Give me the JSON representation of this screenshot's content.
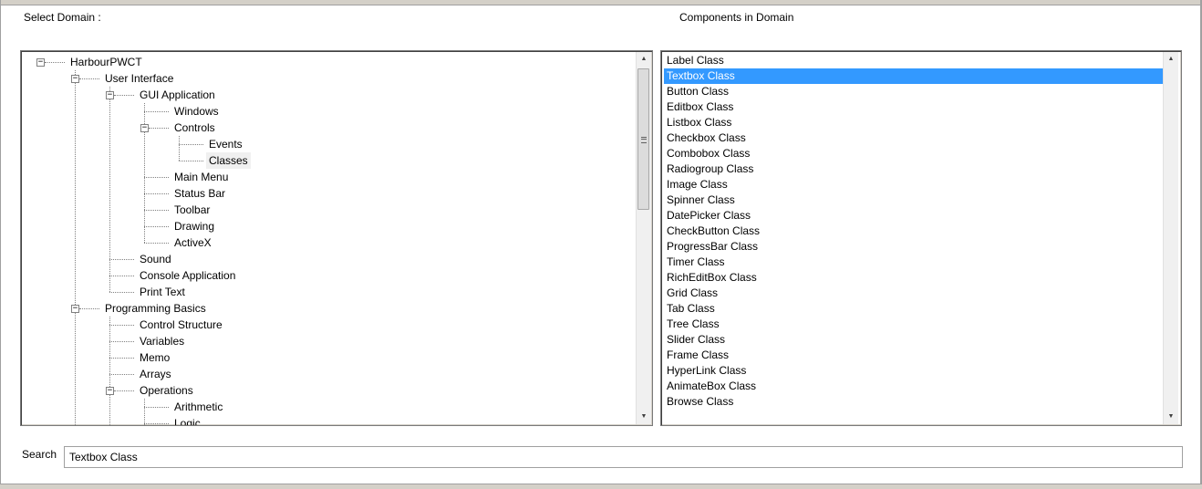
{
  "labels": {
    "select_domain": "Select Domain :",
    "components_in_domain": "Components in Domain",
    "search": "Search"
  },
  "tree": {
    "nodes": [
      {
        "label": "HarbourPWCT",
        "depth": 0,
        "expanded": true
      },
      {
        "label": "User Interface",
        "depth": 1,
        "expanded": true
      },
      {
        "label": "GUI Application",
        "depth": 2,
        "expanded": true
      },
      {
        "label": "Windows",
        "depth": 3
      },
      {
        "label": "Controls",
        "depth": 3,
        "expanded": true
      },
      {
        "label": "Events",
        "depth": 4
      },
      {
        "label": "Classes",
        "depth": 4,
        "selected": true
      },
      {
        "label": "Main Menu",
        "depth": 3
      },
      {
        "label": "Status Bar",
        "depth": 3
      },
      {
        "label": "Toolbar",
        "depth": 3
      },
      {
        "label": "Drawing",
        "depth": 3
      },
      {
        "label": "ActiveX",
        "depth": 3
      },
      {
        "label": "Sound",
        "depth": 2
      },
      {
        "label": "Console Application",
        "depth": 2
      },
      {
        "label": "Print Text",
        "depth": 2
      },
      {
        "label": "Programming Basics",
        "depth": 1,
        "expanded": true
      },
      {
        "label": "Control Structure",
        "depth": 2
      },
      {
        "label": "Variables",
        "depth": 2
      },
      {
        "label": "Memo",
        "depth": 2
      },
      {
        "label": "Arrays",
        "depth": 2
      },
      {
        "label": "Operations",
        "depth": 2,
        "expanded": true
      },
      {
        "label": "Arithmetic",
        "depth": 3
      },
      {
        "label": "Logic",
        "depth": 3
      }
    ]
  },
  "components": {
    "items": [
      "Label Class",
      "Textbox Class",
      "Button Class",
      "Editbox Class",
      "Listbox Class",
      "Checkbox Class",
      "Combobox Class",
      "Radiogroup Class",
      "Image Class",
      "Spinner Class",
      "DatePicker Class",
      "CheckButton Class",
      "ProgressBar Class",
      "Timer Class",
      "RichEditBox Class",
      "Grid Class",
      "Tab Class",
      "Tree Class",
      "Slider Class",
      "Frame Class",
      "HyperLink Class",
      "AnimateBox Class",
      "Browse Class"
    ],
    "selected_index": 1
  },
  "search": {
    "value": "Textbox Class"
  },
  "icons": {
    "scroll_up": "scroll-up-arrow-icon",
    "scroll_down": "scroll-down-arrow-icon",
    "collapse": "collapse-minus-icon"
  },
  "colors": {
    "selection": "#3399ff",
    "tree_selection": "#f0f0f0"
  }
}
